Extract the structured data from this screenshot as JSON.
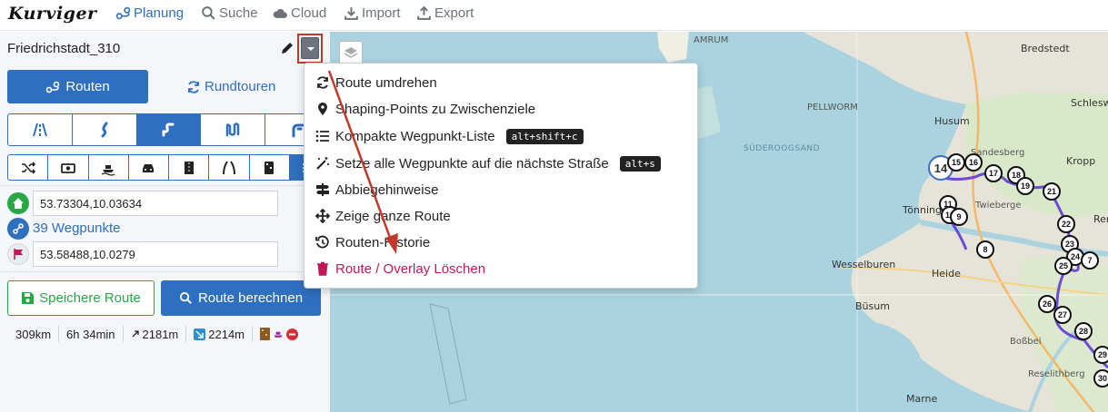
{
  "app": {
    "logo": "Kurviger"
  },
  "nav": [
    {
      "label": "Planung",
      "icon": "route-icon"
    },
    {
      "label": "Suche",
      "icon": "search-icon"
    },
    {
      "label": "Cloud",
      "icon": "cloud-icon"
    },
    {
      "label": "Import",
      "icon": "download-icon"
    },
    {
      "label": "Export",
      "icon": "upload-icon"
    }
  ],
  "route": {
    "name": "Friedrichstadt_310",
    "tab_routen": "Routen",
    "tab_rundtouren": "Rundtouren",
    "start": "53.73304,10.03634",
    "waypoints": "39 Wegpunkte",
    "end": "53.58488,10.0279",
    "save": "Speichere Route",
    "calc": "Route berechnen"
  },
  "stats": {
    "distance": "309km",
    "duration": "6h 34min",
    "ascent": "2181m",
    "descent": "2214m"
  },
  "menu": {
    "items": [
      {
        "label": "Route umdrehen",
        "icon": "reverse-icon"
      },
      {
        "label": "Shaping-Points zu Zwischenziele",
        "icon": "map-marker-icon"
      },
      {
        "label": "Kompakte Wegpunkt-Liste",
        "icon": "list-icon",
        "shortcut": "alt+shift+c"
      },
      {
        "label": "Setze alle Wegpunkte auf die nächste Straße",
        "icon": "magic-wand-icon",
        "shortcut": "alt+s"
      },
      {
        "label": "Abbiegehinweise",
        "icon": "signpost-icon"
      },
      {
        "label": "Zeige ganze Route",
        "icon": "arrows-expand-icon"
      },
      {
        "label": "Routen-Historie",
        "icon": "history-icon"
      },
      {
        "label": "Route / Overlay Löschen",
        "icon": "trash-icon"
      }
    ]
  },
  "map": {
    "labels": [
      "Bredstedt",
      "AMRUM",
      "PELLWORM",
      "Husum",
      "Schleswig",
      "SÜDEROOGSAND",
      "Sandesberg",
      "Kropp",
      "Tönning",
      "Twieberge",
      "Rendsburg",
      "Wesselburen",
      "Heide",
      "Büsum",
      "Boßbei",
      "Marne",
      "Reselithberg"
    ],
    "pins": [
      "14",
      "15",
      "16",
      "17",
      "18",
      "19",
      "21",
      "11",
      "10",
      "9",
      "22",
      "23",
      "24",
      "25",
      "7",
      "8",
      "26",
      "27",
      "28",
      "29",
      "30"
    ]
  }
}
